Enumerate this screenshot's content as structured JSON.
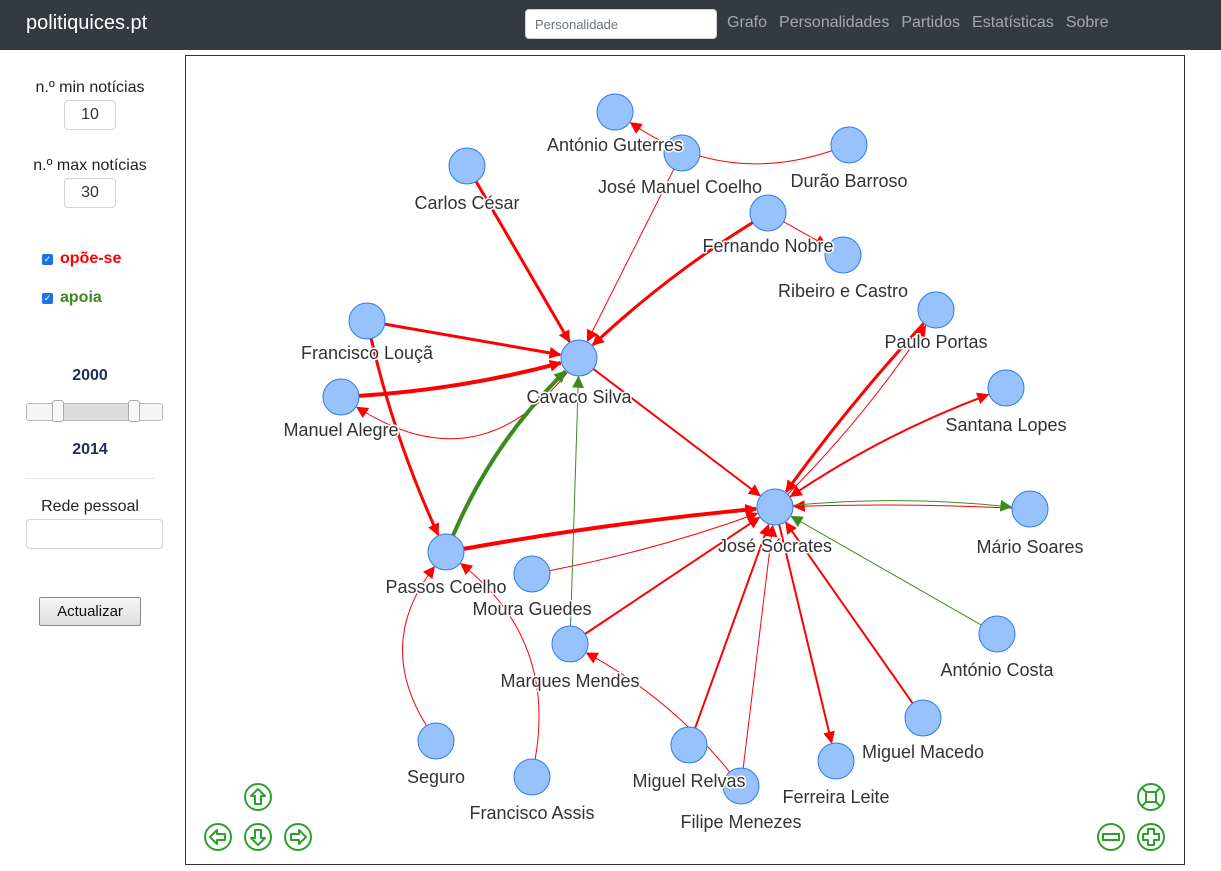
{
  "header": {
    "brand": "politiquices.pt",
    "search_placeholder": "Personalidade",
    "links": [
      "Grafo",
      "Personalidades",
      "Partidos",
      "Estatísticas",
      "Sobre"
    ]
  },
  "sidebar": {
    "min_label": "n.º min notícias",
    "min_value": "10",
    "max_label": "n.º max notícias",
    "max_value": "30",
    "oppose_label": "opõe-se",
    "support_label": "apoia",
    "year_start": "2000",
    "year_end": "2014",
    "personal_network_label": "Rede pessoal",
    "personal_network_value": "",
    "update_button": "Actualizar"
  },
  "colors": {
    "oppose": "#ff0000",
    "support": "#3c8a1e",
    "node_fill": "#97c2fc",
    "node_stroke": "#2b7ce9",
    "nav_green": "#2ca02c"
  },
  "graph": {
    "nodes": [
      {
        "id": "ag",
        "label": "António Guterres"
      },
      {
        "id": "jmc",
        "label": "José Manuel Coelho"
      },
      {
        "id": "db",
        "label": "Durão Barroso"
      },
      {
        "id": "cc",
        "label": "Carlos César"
      },
      {
        "id": "fn",
        "label": "Fernando Nobre"
      },
      {
        "id": "rc",
        "label": "Ribeiro e Castro"
      },
      {
        "id": "pp",
        "label": "Paulo Portas"
      },
      {
        "id": "fl",
        "label": "Francisco Louçã"
      },
      {
        "id": "ma",
        "label": "Manuel Alegre"
      },
      {
        "id": "cs",
        "label": "Cavaco Silva"
      },
      {
        "id": "sl",
        "label": "Santana Lopes"
      },
      {
        "id": "js",
        "label": "José Sócrates"
      },
      {
        "id": "ms",
        "label": "Mário Soares"
      },
      {
        "id": "pc",
        "label": "Passos Coelho"
      },
      {
        "id": "mg",
        "label": "Moura Guedes"
      },
      {
        "id": "mm",
        "label": "Marques Mendes"
      },
      {
        "id": "ac",
        "label": "António Costa"
      },
      {
        "id": "mmac",
        "label": "Miguel Macedo"
      },
      {
        "id": "seg",
        "label": "Seguro"
      },
      {
        "id": "fa",
        "label": "Francisco Assis"
      },
      {
        "id": "mr",
        "label": "Miguel Relvas"
      },
      {
        "id": "fle",
        "label": "Ferreira Leite"
      },
      {
        "id": "fm",
        "label": "Filipe Menezes"
      }
    ],
    "edges": [
      {
        "from": "db",
        "to": "ag",
        "type": "oppose",
        "weight": 1
      },
      {
        "from": "jmc",
        "to": "cs",
        "type": "oppose",
        "weight": 1
      },
      {
        "from": "cc",
        "to": "cs",
        "type": "oppose",
        "weight": 3
      },
      {
        "from": "fn",
        "to": "cs",
        "type": "oppose",
        "weight": 3
      },
      {
        "from": "fl",
        "to": "cs",
        "type": "oppose",
        "weight": 3
      },
      {
        "from": "cs",
        "to": "ma",
        "type": "oppose",
        "weight": 1
      },
      {
        "from": "ma",
        "to": "cs",
        "type": "oppose",
        "weight": 4
      },
      {
        "from": "fl",
        "to": "pc",
        "type": "oppose",
        "weight": 3
      },
      {
        "from": "pc",
        "to": "cs",
        "type": "support",
        "weight": 4
      },
      {
        "from": "pc",
        "to": "js",
        "type": "oppose",
        "weight": 4
      },
      {
        "from": "mg",
        "to": "js",
        "type": "oppose",
        "weight": 1
      },
      {
        "from": "mm",
        "to": "cs",
        "type": "support",
        "weight": 1
      },
      {
        "from": "cs",
        "to": "js",
        "type": "oppose",
        "weight": 2
      },
      {
        "from": "fn",
        "to": "rc",
        "type": "oppose",
        "weight": 1
      },
      {
        "from": "pp",
        "to": "js",
        "type": "oppose",
        "weight": 3
      },
      {
        "from": "js",
        "to": "pp",
        "type": "oppose",
        "weight": 1
      },
      {
        "from": "js",
        "to": "sl",
        "type": "oppose",
        "weight": 2
      },
      {
        "from": "sl",
        "to": "js",
        "type": "oppose",
        "weight": 1
      },
      {
        "from": "ms",
        "to": "js",
        "type": "oppose",
        "weight": 1
      },
      {
        "from": "js",
        "to": "ms",
        "type": "support",
        "weight": 1
      },
      {
        "from": "ac",
        "to": "js",
        "type": "support",
        "weight": 1
      },
      {
        "from": "mmac",
        "to": "js",
        "type": "oppose",
        "weight": 2
      },
      {
        "from": "js",
        "to": "fle",
        "type": "oppose",
        "weight": 2
      },
      {
        "from": "mr",
        "to": "js",
        "type": "oppose",
        "weight": 2
      },
      {
        "from": "fm",
        "to": "js",
        "type": "oppose",
        "weight": 1
      },
      {
        "from": "mm",
        "to": "js",
        "type": "oppose",
        "weight": 2
      },
      {
        "from": "seg",
        "to": "pc",
        "type": "oppose",
        "weight": 1
      },
      {
        "from": "fa",
        "to": "pc",
        "type": "oppose",
        "weight": 1
      },
      {
        "from": "fm",
        "to": "mm",
        "type": "oppose",
        "weight": 1
      }
    ]
  },
  "nav_controls": [
    "arrow-up-icon",
    "arrow-left-icon",
    "arrow-down-icon",
    "arrow-right-icon",
    "zoom-out-icon",
    "zoom-in-icon",
    "fit-icon"
  ]
}
